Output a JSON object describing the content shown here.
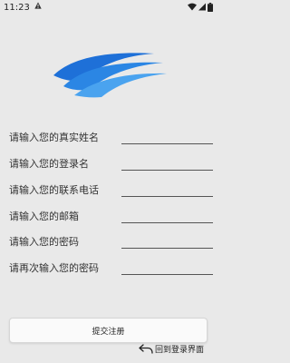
{
  "status_bar": {
    "time": "11:23",
    "warning_icon": "warning-icon",
    "wifi_icon": "wifi-icon",
    "signal_icon": "cell-signal-icon",
    "battery_icon": "battery-icon"
  },
  "logo": {
    "icon": "wave-logo-icon",
    "color_dark": "#1e70d8",
    "color_light": "#4aa3ef"
  },
  "form": {
    "fields": [
      {
        "label": "请输入您的真实姓名",
        "value": ""
      },
      {
        "label": "请输入您的登录名",
        "value": ""
      },
      {
        "label": "请输入您的联系电话",
        "value": ""
      },
      {
        "label": "请输入您的邮箱",
        "value": ""
      },
      {
        "label": "请输入您的密码",
        "value": ""
      },
      {
        "label": "请再次输入您的密码",
        "value": ""
      }
    ],
    "submit_label": "提交注册",
    "back_icon": "undo-arrow-icon",
    "back_label": "回到登录界面"
  },
  "colors": {
    "background": "#e9e9e9",
    "button_bg": "#fafafa",
    "underline": "#555555"
  }
}
